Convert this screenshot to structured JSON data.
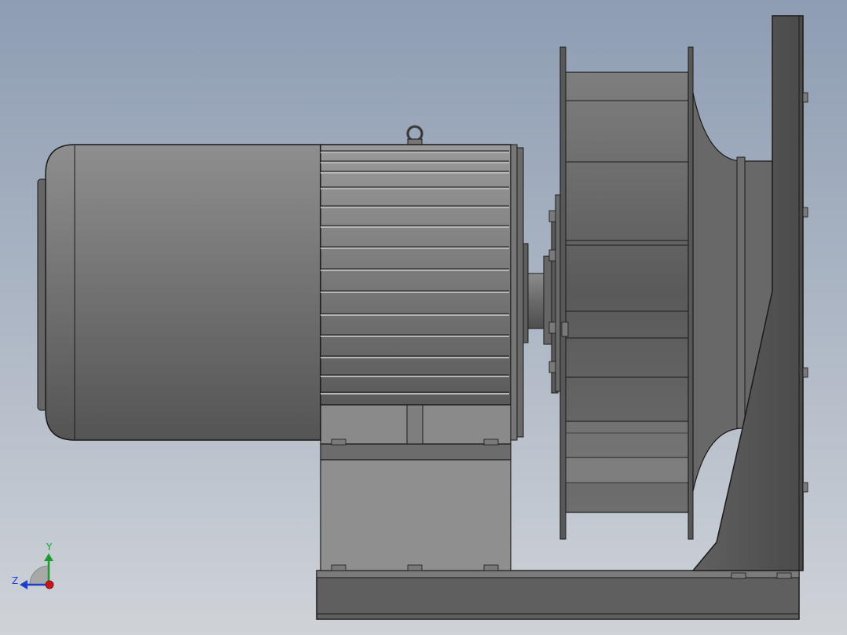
{
  "triad": {
    "y_label": "Y",
    "z_label": "Z",
    "y_color": "#1f9a2f",
    "z_color": "#1f3fc8",
    "x_color": "#c8141e"
  },
  "palette": {
    "background_top": "#8e9db3",
    "background_bottom": "#cfd3d8",
    "metal_dark": "#4a4a4a",
    "metal_mid": "#767676",
    "metal_light": "#a6a6a6",
    "edge": "#1a1a1a"
  }
}
